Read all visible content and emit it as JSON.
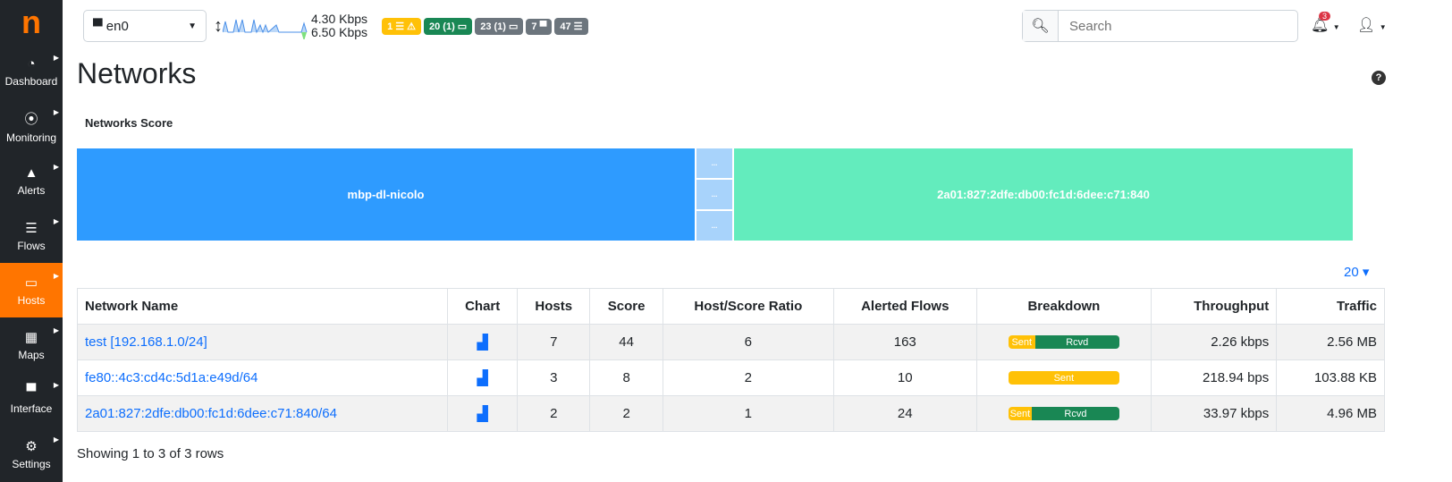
{
  "sidebar": {
    "logo": "n",
    "items": [
      {
        "label": "Dashboard",
        "icon": "gauge-icon",
        "glyph": "◔"
      },
      {
        "label": "Monitoring",
        "icon": "satellite-icon",
        "glyph": "⦿"
      },
      {
        "label": "Alerts",
        "icon": "warning-icon",
        "glyph": "▲"
      },
      {
        "label": "Flows",
        "icon": "list-icon",
        "glyph": "☰"
      },
      {
        "label": "Hosts",
        "icon": "laptop-icon",
        "glyph": "▭",
        "active": true
      },
      {
        "label": "Maps",
        "icon": "map-icon",
        "glyph": "▦"
      },
      {
        "label": "Interface",
        "icon": "ethernet-icon",
        "glyph": "▀"
      },
      {
        "label": "Settings",
        "icon": "gear-icon",
        "glyph": "⚙"
      }
    ]
  },
  "topbar": {
    "interface": "en0",
    "upload": "4.30 Kbps",
    "download": "6.50 Kbps",
    "badges": [
      {
        "text": "1 ☰ ⚠",
        "color": "#ffc107"
      },
      {
        "text": "20 (1) ▭",
        "color": "#198754"
      },
      {
        "text": "23 (1) ▭",
        "color": "#6c757d"
      },
      {
        "text": "7 ▀",
        "color": "#6c757d"
      },
      {
        "text": "47 ☰",
        "color": "#6c757d"
      }
    ],
    "search_placeholder": "Search",
    "notifications": "3"
  },
  "page": {
    "title": "Networks",
    "score_title": "Networks Score",
    "page_size": "20 ▾",
    "treemap": [
      {
        "label": "mbp-dl-nicolo",
        "color": "#2e9bff"
      },
      {
        "label": "...",
        "color": "#a8d3fb"
      },
      {
        "label": "...",
        "color": "#a8d3fb"
      },
      {
        "label": "...",
        "color": "#a8d3fb"
      },
      {
        "label": "2a01:827:2dfe:db00:fc1d:6dee:c71:840",
        "color": "#63ecbd"
      }
    ]
  },
  "table": {
    "columns": [
      "Network Name",
      "Chart",
      "Hosts",
      "Score",
      "Host/Score Ratio",
      "Alerted Flows",
      "Breakdown",
      "Throughput",
      "Traffic"
    ],
    "rows": [
      {
        "name": "test [192.168.1.0/24]",
        "hosts": "7",
        "score": "44",
        "ratio": "6",
        "alerted": "163",
        "sent_pct": 24,
        "throughput": "2.26 kbps",
        "traffic": "2.56 MB"
      },
      {
        "name": "fe80::4c3:cd4c:5d1a:e49d/64",
        "hosts": "3",
        "score": "8",
        "ratio": "2",
        "alerted": "10",
        "sent_pct": 100,
        "throughput": "218.94 bps",
        "traffic": "103.88 KB"
      },
      {
        "name": "2a01:827:2dfe:db00:fc1d:6dee:c71:840/64",
        "hosts": "2",
        "score": "2",
        "ratio": "1",
        "alerted": "24",
        "sent_pct": 21,
        "throughput": "33.97 kbps",
        "traffic": "4.96 MB"
      }
    ],
    "sent_label": "Sent",
    "rcvd_label": "Rcvd",
    "footer": "Showing 1 to 3 of 3 rows"
  },
  "colors": {
    "accent": "#ff7500",
    "sent": "#ffc107",
    "rcvd": "#198754",
    "link": "#0d6efd"
  }
}
